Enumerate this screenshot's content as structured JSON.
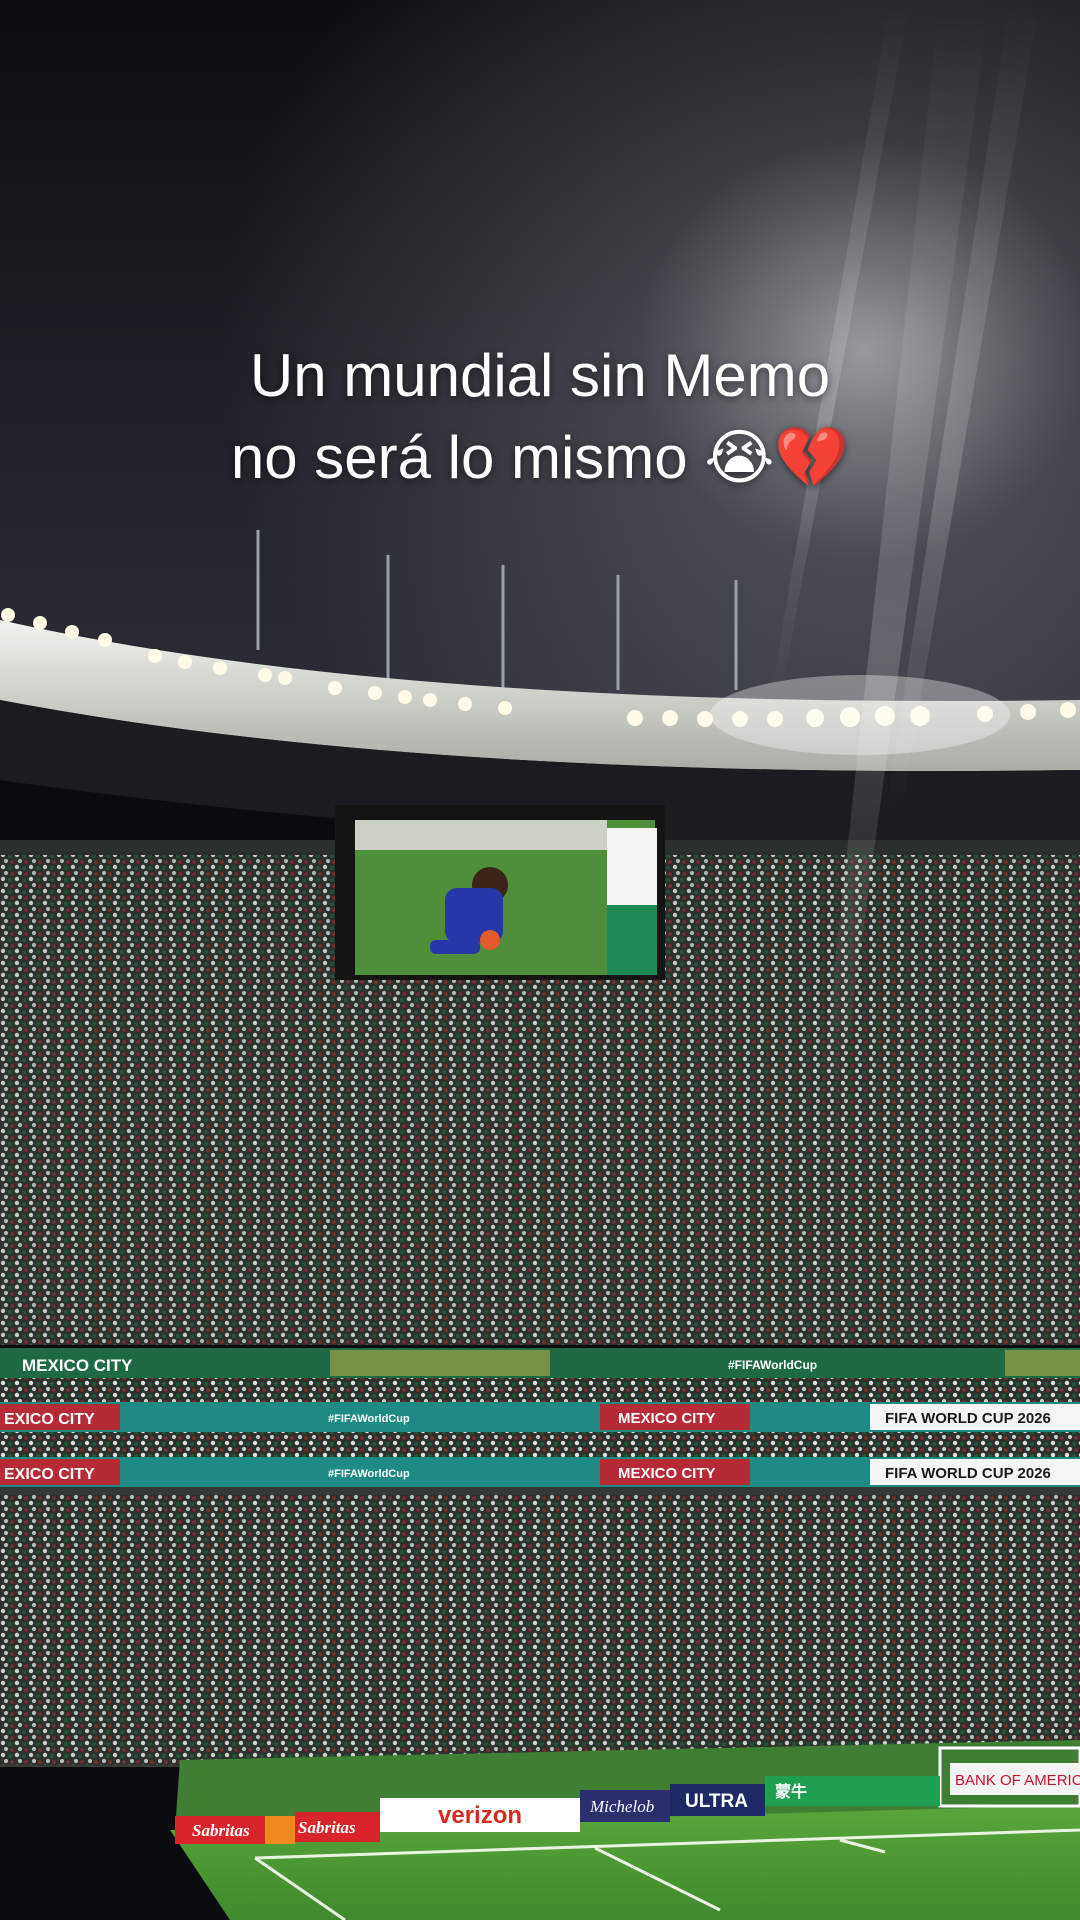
{
  "caption": {
    "line1": "Un mundial sin Memo",
    "line2": "no será lo mismo",
    "emoji": "😭💔"
  },
  "banners": {
    "upper_city": "MEXICO CITY",
    "upper_hashtag": "#FIFAWorldCup",
    "ribbon_city": "MEXICO CITY",
    "ribbon_cup": "FIFA WORLD CUP 2026",
    "ribbon_hashtag": "#FIFAWorldCup",
    "ribbon_city_left": "EXICO CITY"
  },
  "ad_boards": {
    "sabritas": "Sabritas",
    "verizon": "verizon",
    "michelob": "Michelob",
    "ultra": "ULTRA",
    "mengniu": "蒙牛",
    "bank": "BANK OF AMERICA"
  },
  "colors": {
    "sky": "#101117",
    "roof": "#d9dcd6",
    "crowd": "#2b302c",
    "pitch": "#4f9b35",
    "banner_green": "#1d6a45",
    "ribbon_teal": "#1e8a82"
  }
}
